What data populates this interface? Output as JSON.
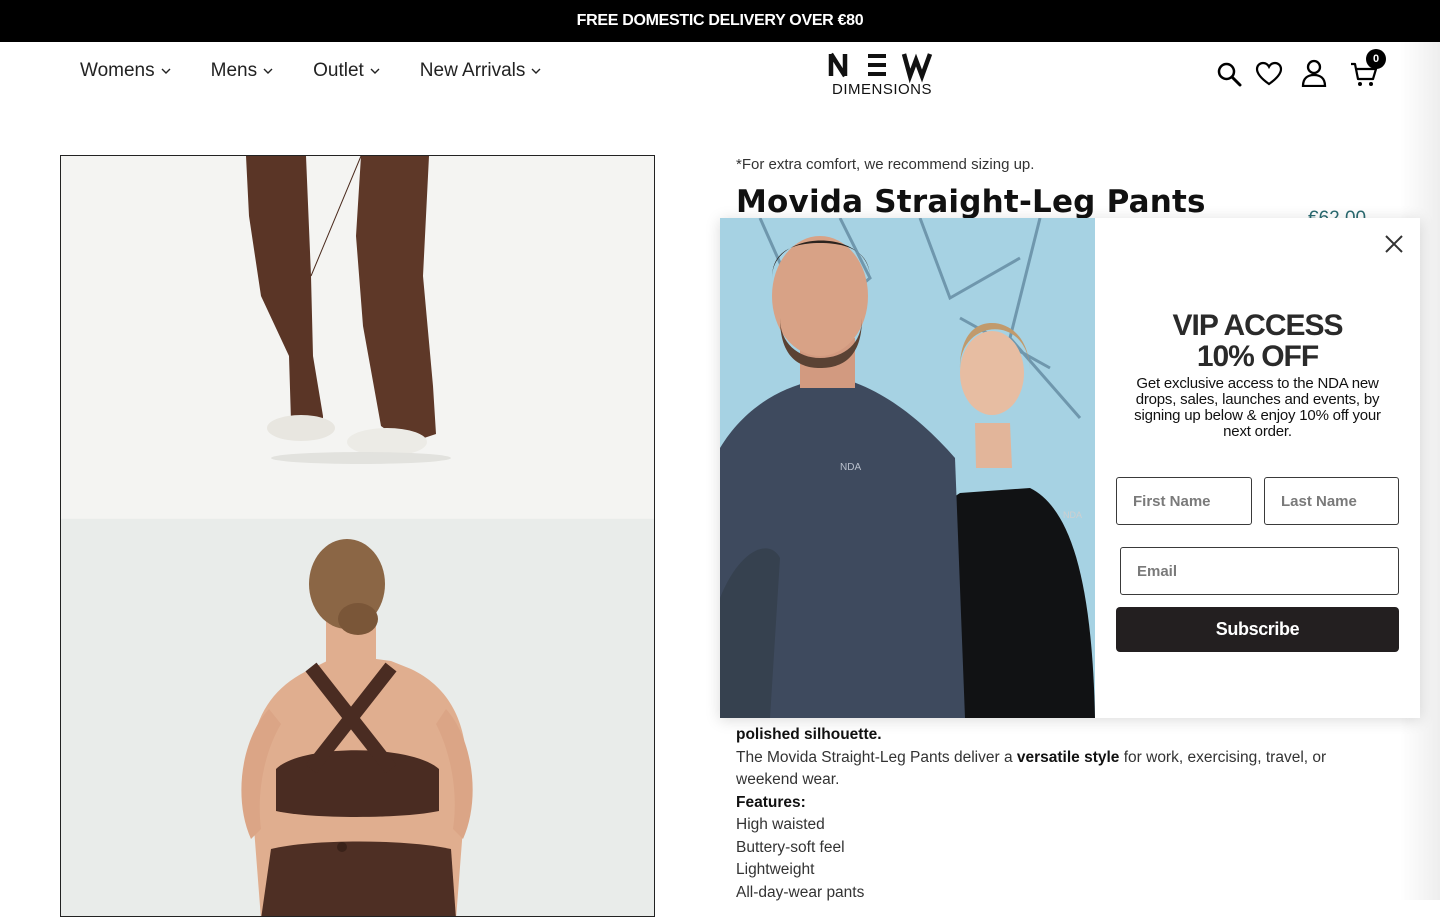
{
  "announcement": {
    "text": "FREE DOMESTIC DELIVERY OVER €80"
  },
  "nav": {
    "items": [
      {
        "label": "Womens"
      },
      {
        "label": "Mens"
      },
      {
        "label": "Outlet"
      },
      {
        "label": "New Arrivals"
      }
    ]
  },
  "logo": {
    "line1": "N E W",
    "line2": "DIMENSIONS"
  },
  "header_icons": {
    "search": "search-icon",
    "wishlist": "heart-icon",
    "account": "user-icon",
    "cart": "cart-icon",
    "cart_count": "0"
  },
  "product": {
    "sizing_note": "*For extra comfort, we recommend sizing up.",
    "title": "Movida Straight-Leg Pants",
    "price": "€62.00",
    "description": {
      "line_silhouette": "polished silhouette.",
      "p2_prefix": "The Movida Straight-Leg Pants deliver a ",
      "p2_bold": "versatile style",
      "p2_suffix": " for work, exercising, travel, or weekend wear.",
      "features_heading": "Features:",
      "features": [
        "High waisted",
        "Buttery-soft feel",
        "Lightweight",
        "All-day-wear pants"
      ]
    }
  },
  "popup": {
    "heading_line1": "VIP ACCESS",
    "heading_line2": "10% OFF",
    "body": "Get exclusive access to the NDA new drops, sales, launches and events, by signing up below & enjoy 10% off your next order.",
    "first_name_placeholder": "First Name",
    "last_name_placeholder": "Last Name",
    "email_placeholder": "Email",
    "subscribe_label": "Subscribe",
    "image_brand_text": "NDA"
  },
  "colors": {
    "announcement_bg": "#000000",
    "price": "#2a6a70",
    "subscribe_bg": "#231f20"
  }
}
